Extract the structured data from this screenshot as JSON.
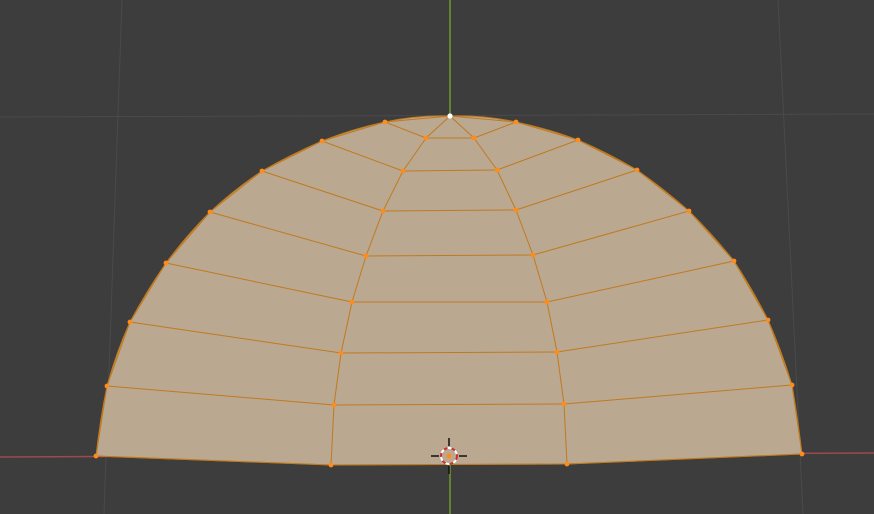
{
  "viewport": {
    "view": "front-orthographic",
    "background": "#3d3d3d",
    "grid_color": "#4a4a4a",
    "z_axis_color": "#6f9a2e",
    "x_axis_color": "#9b4a4f",
    "mesh": {
      "name": "half-dome",
      "mode": "edit",
      "face_fill": "#bba891",
      "edge_color": "#c07a1e",
      "selected_vertex_color": "#ff8c1a",
      "active_vertex_color": "#ffffff",
      "vertex_rows": 9,
      "vertex_columns": 4
    },
    "cursor": {
      "name": "3d-cursor",
      "ring_colors": [
        "#c83232",
        "#ffffff"
      ]
    }
  }
}
